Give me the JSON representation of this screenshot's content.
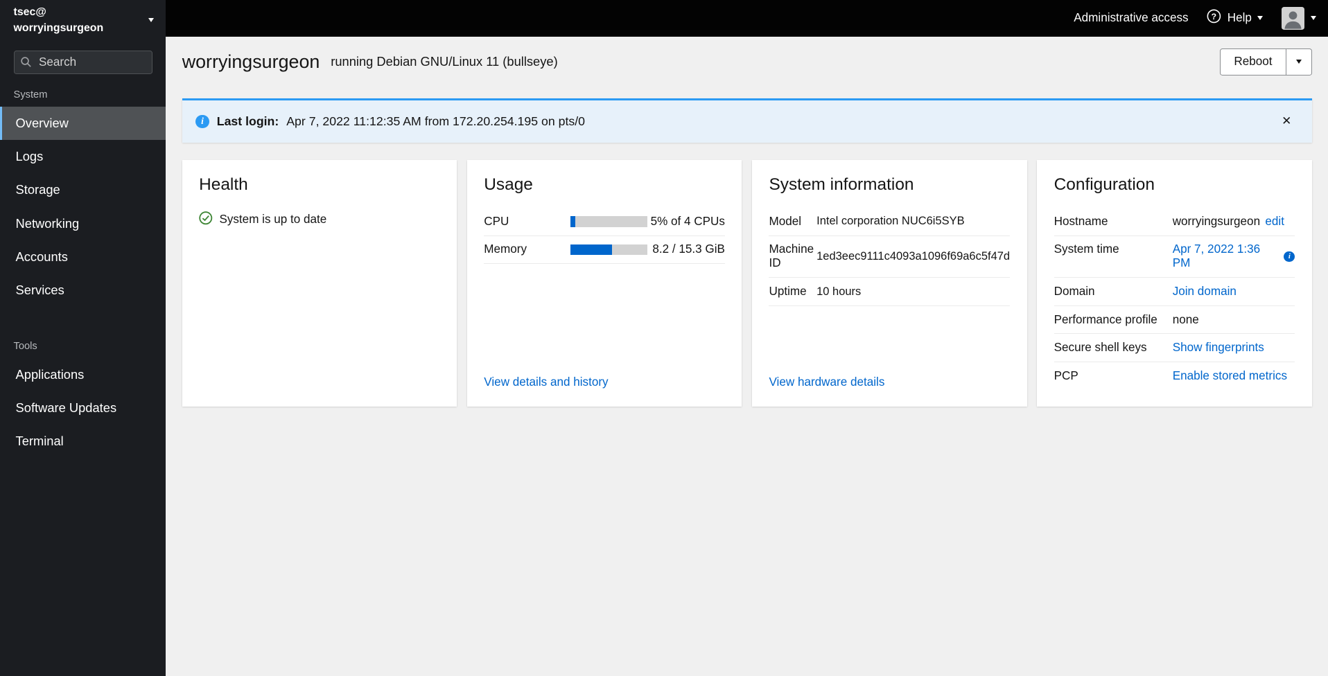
{
  "colors": {
    "accent_blue": "#0066cc",
    "alert_info_blue": "#2b9af3",
    "success_green": "#3e8635",
    "nav_selected_border": "#73bcf7",
    "sidebar_bg": "#1b1d21",
    "topbar_bg": "#030303"
  },
  "sidebar": {
    "user": "tsec@",
    "host": "worryingsurgeon",
    "search_placeholder": "Search",
    "selected_item": "Overview",
    "sections": [
      {
        "label": "System",
        "items": [
          "Overview",
          "Logs",
          "Storage",
          "Networking",
          "Accounts",
          "Services"
        ]
      },
      {
        "label": "Tools",
        "items": [
          "Applications",
          "Software Updates",
          "Terminal"
        ]
      }
    ]
  },
  "topbar": {
    "admin_access_label": "Administrative access",
    "help_label": "Help"
  },
  "header": {
    "hostname": "worryingsurgeon",
    "os": "running Debian GNU/Linux 11 (bullseye)",
    "reboot_label": "Reboot"
  },
  "alert": {
    "title": "Last login:",
    "message": "Apr 7, 2022 11:12:35 AM from 172.20.254.195 on pts/0"
  },
  "cards": {
    "health": {
      "title": "Health",
      "status": "System is up to date"
    },
    "usage": {
      "title": "Usage",
      "cpu": {
        "label": "CPU",
        "value": "5% of 4 CPUs",
        "percent": 6
      },
      "memory": {
        "label": "Memory",
        "value": "8.2 / 15.3 GiB",
        "percent": 54
      },
      "link": "View details and history"
    },
    "system_information": {
      "title": "System information",
      "rows": [
        {
          "label": "Model",
          "value": "Intel corporation NUC6i5SYB"
        },
        {
          "label": "Machine ID",
          "value": "1ed3eec9111c4093a1096f69a6c5f47d"
        },
        {
          "label": "Uptime",
          "value": "10 hours"
        }
      ],
      "link": "View hardware details"
    },
    "configuration": {
      "title": "Configuration",
      "rows": [
        {
          "label": "Hostname",
          "value": "worryingsurgeon",
          "link": "edit"
        },
        {
          "label": "System time",
          "link": "Apr 7, 2022 1:36 PM"
        },
        {
          "label": "Domain",
          "link": "Join domain"
        },
        {
          "label": "Performance profile",
          "value": "none"
        },
        {
          "label": "Secure shell keys",
          "link": "Show fingerprints"
        },
        {
          "label": "PCP",
          "link": "Enable stored metrics"
        }
      ]
    }
  }
}
